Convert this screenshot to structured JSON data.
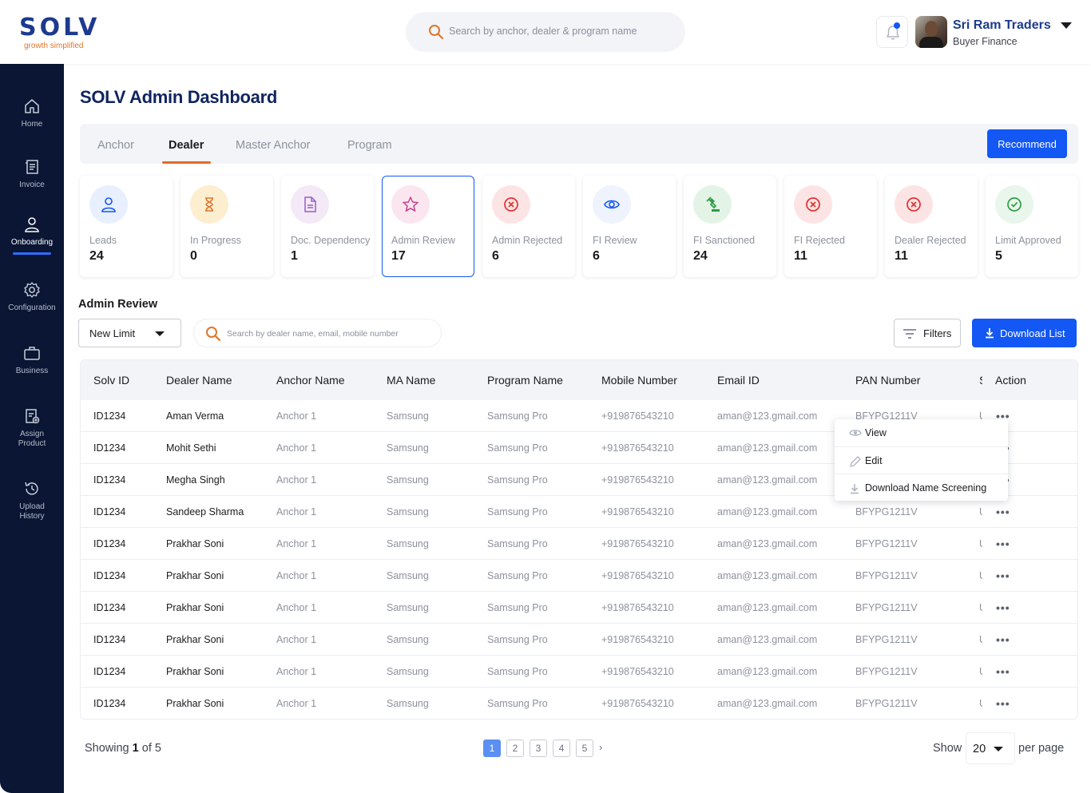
{
  "brand": {
    "name": "SOLV",
    "tagline": "growth simplified"
  },
  "header": {
    "search_placeholder": "Search by anchor, dealer & program name",
    "user_name": "Sri Ram Traders",
    "user_role": "Buyer Finance"
  },
  "sidebar": {
    "items": [
      {
        "label": "Home",
        "icon": "home-icon"
      },
      {
        "label": "Invoice",
        "icon": "invoice-icon"
      },
      {
        "label": "Onboarding",
        "icon": "user-icon"
      },
      {
        "label": "Configuration",
        "icon": "gear-icon"
      },
      {
        "label": "Business",
        "icon": "briefcase-icon"
      },
      {
        "label": "Assign Product",
        "icon": "assign-product-icon"
      },
      {
        "label": "Upload History",
        "icon": "history-icon"
      }
    ],
    "active_index": 2
  },
  "page": {
    "title": "SOLV Admin Dashboard"
  },
  "tabs": [
    {
      "label": "Anchor"
    },
    {
      "label": "Dealer"
    },
    {
      "label": "Master Anchor"
    },
    {
      "label": "Program"
    }
  ],
  "active_tab": "Dealer",
  "recommend_label": "Recommend",
  "stats": [
    {
      "label": "Leads",
      "value": "24",
      "icon": "user-icon",
      "color": "#1357f5"
    },
    {
      "label": "In Progress",
      "value": "0",
      "icon": "hourglass-icon",
      "color": "#e0762a"
    },
    {
      "label": "Doc. Dependency",
      "value": "1",
      "icon": "document-icon",
      "color": "#9c5cc6"
    },
    {
      "label": "Admin Review",
      "value": "17",
      "icon": "star-icon",
      "color": "#c2438d"
    },
    {
      "label": "Admin Rejected",
      "value": "6",
      "icon": "x-circle-icon",
      "color": "#e03131"
    },
    {
      "label": "FI Review",
      "value": "6",
      "icon": "eye-icon",
      "color": "#1357f5"
    },
    {
      "label": "FI Sanctioned",
      "value": "24",
      "icon": "gavel-icon",
      "color": "#2f9e44"
    },
    {
      "label": "FI Rejected",
      "value": "11",
      "icon": "x-circle-icon",
      "color": "#e03131"
    },
    {
      "label": "Dealer Rejected",
      "value": "11",
      "icon": "x-circle-icon",
      "color": "#e03131"
    },
    {
      "label": "Limit Approved",
      "value": "5",
      "icon": "check-circle-icon",
      "color": "#2f9e44"
    }
  ],
  "section": {
    "title": "Admin Review",
    "filter_select": "New Limit",
    "search_placeholder": "Search by dealer name, email, mobile number",
    "filters_label": "Filters",
    "download_label": "Download List"
  },
  "table": {
    "columns": [
      "Solv ID",
      "Dealer Name",
      "Anchor Name",
      "MA Name",
      "Program Name",
      "Mobile Number",
      "Email ID",
      "PAN Number",
      "S",
      "Action"
    ],
    "rows": [
      [
        "ID1234",
        "Aman Verma",
        "Anchor 1",
        "Samsung",
        "Samsung Pro",
        "+919876543210",
        "aman@123.gmail.com",
        "BFYPG1211V",
        "U"
      ],
      [
        "ID1234",
        "Mohit Sethi",
        "Anchor 1",
        "Samsung",
        "Samsung Pro",
        "+919876543210",
        "aman@123.gmail.com",
        "BFYPG1211V",
        "U"
      ],
      [
        "ID1234",
        "Megha Singh",
        "Anchor 1",
        "Samsung",
        "Samsung Pro",
        "+919876543210",
        "aman@123.gmail.com",
        "BFYPG1211V",
        "U"
      ],
      [
        "ID1234",
        "Sandeep Sharma",
        "Anchor 1",
        "Samsung",
        "Samsung Pro",
        "+919876543210",
        "aman@123.gmail.com",
        "BFYPG1211V",
        "U"
      ],
      [
        "ID1234",
        "Prakhar Soni",
        "Anchor 1",
        "Samsung",
        "Samsung Pro",
        "+919876543210",
        "aman@123.gmail.com",
        "BFYPG1211V",
        "U"
      ],
      [
        "ID1234",
        "Prakhar Soni",
        "Anchor 1",
        "Samsung",
        "Samsung Pro",
        "+919876543210",
        "aman@123.gmail.com",
        "BFYPG1211V",
        "U"
      ],
      [
        "ID1234",
        "Prakhar Soni",
        "Anchor 1",
        "Samsung",
        "Samsung Pro",
        "+919876543210",
        "aman@123.gmail.com",
        "BFYPG1211V",
        "U"
      ],
      [
        "ID1234",
        "Prakhar Soni",
        "Anchor 1",
        "Samsung",
        "Samsung Pro",
        "+919876543210",
        "aman@123.gmail.com",
        "BFYPG1211V",
        "U"
      ],
      [
        "ID1234",
        "Prakhar Soni",
        "Anchor 1",
        "Samsung",
        "Samsung Pro",
        "+919876543210",
        "aman@123.gmail.com",
        "BFYPG1211V",
        "U"
      ],
      [
        "ID1234",
        "Prakhar Soni",
        "Anchor 1",
        "Samsung",
        "Samsung Pro",
        "+919876543210",
        "aman@123.gmail.com",
        "BFYPG1211V",
        "U"
      ]
    ],
    "action_icon": "more-dots-icon"
  },
  "action_menu": [
    {
      "label": "View",
      "icon": "eye-icon"
    },
    {
      "label": "Edit",
      "icon": "pencil-icon"
    },
    {
      "label": "Download Name Screening",
      "icon": "download-icon"
    }
  ],
  "footer": {
    "showing_prefix": "Showing",
    "current_page": "1",
    "of_text": "of",
    "total_pages": "5",
    "pages": [
      "1",
      "2",
      "3",
      "4",
      "5"
    ],
    "next_icon": "chevron-right-icon",
    "show_label": "Show",
    "per_page_value": "20",
    "per_page_label": "per page"
  },
  "colors": {
    "primary": "#1357f5",
    "sidebar": "#0a1634",
    "accent": "#e46a2a",
    "title": "#10245e"
  }
}
